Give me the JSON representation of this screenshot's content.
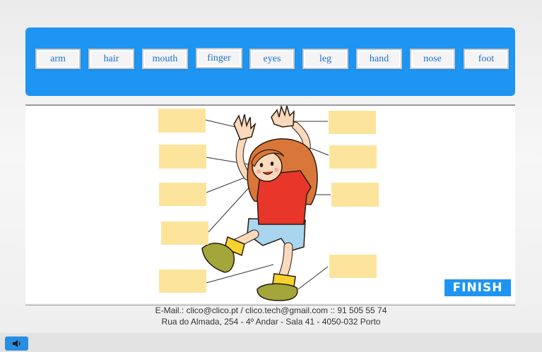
{
  "word_bank": {
    "words": [
      "arm",
      "hair",
      "mouth",
      "finger",
      "eyes",
      "leg",
      "hand",
      "nose",
      "foot"
    ]
  },
  "finish_label": "FINISH",
  "footer": {
    "line1": "E-Mail.: clico@clico.pt / clico.tech@gmail.com :: 91 505 55 74",
    "line2": "Rua do Almada, 254 - 4º Andar - Sala 41 - 4050-032 Porto"
  },
  "icons": {
    "sound": "speaker-icon"
  },
  "colors": {
    "accent": "#1e95f2",
    "drop_box": "#fde49c",
    "shirt": "#e8372a",
    "hair": "#d9773a"
  }
}
